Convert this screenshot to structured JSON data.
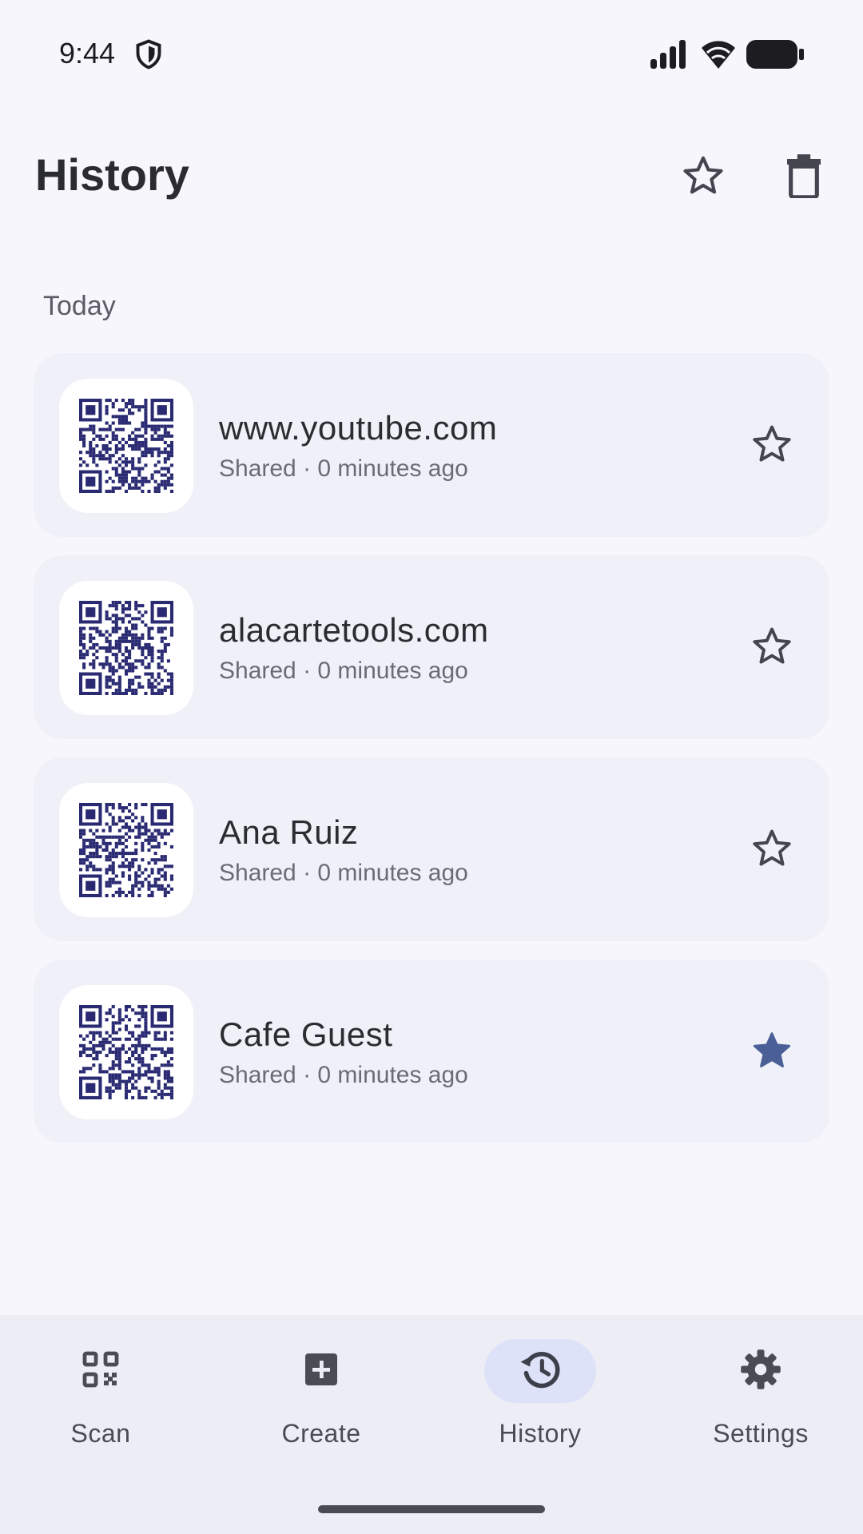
{
  "status_bar": {
    "time": "9:44",
    "icons": [
      "shield-icon",
      "signal-icon",
      "wifi-icon",
      "battery-icon"
    ]
  },
  "header": {
    "title": "History",
    "actions": [
      "star-outline-icon",
      "delete-icon"
    ]
  },
  "section": {
    "label": "Today"
  },
  "items": [
    {
      "title": "www.youtube.com",
      "subtitle": "Shared · 0 minutes ago",
      "favorite": false
    },
    {
      "title": "alacartetools.com",
      "subtitle": "Shared · 0 minutes ago",
      "favorite": false
    },
    {
      "title": "Ana Ruiz",
      "subtitle": "Shared · 0 minutes ago",
      "favorite": false
    },
    {
      "title": "Cafe Guest",
      "subtitle": "Shared · 0 minutes ago",
      "favorite": true
    }
  ],
  "nav": {
    "items": [
      {
        "label": "Scan",
        "icon": "qr-scan-icon",
        "active": false
      },
      {
        "label": "Create",
        "icon": "add-box-icon",
        "active": false
      },
      {
        "label": "History",
        "icon": "history-icon",
        "active": true
      },
      {
        "label": "Settings",
        "icon": "gear-icon",
        "active": false
      }
    ]
  },
  "colors": {
    "background": "#F8F6FD",
    "card": "#F0F1F8",
    "qr": "#2A2A73",
    "star_filled": "#4A5F96",
    "nav_active_pill": "#DDE2F8"
  }
}
